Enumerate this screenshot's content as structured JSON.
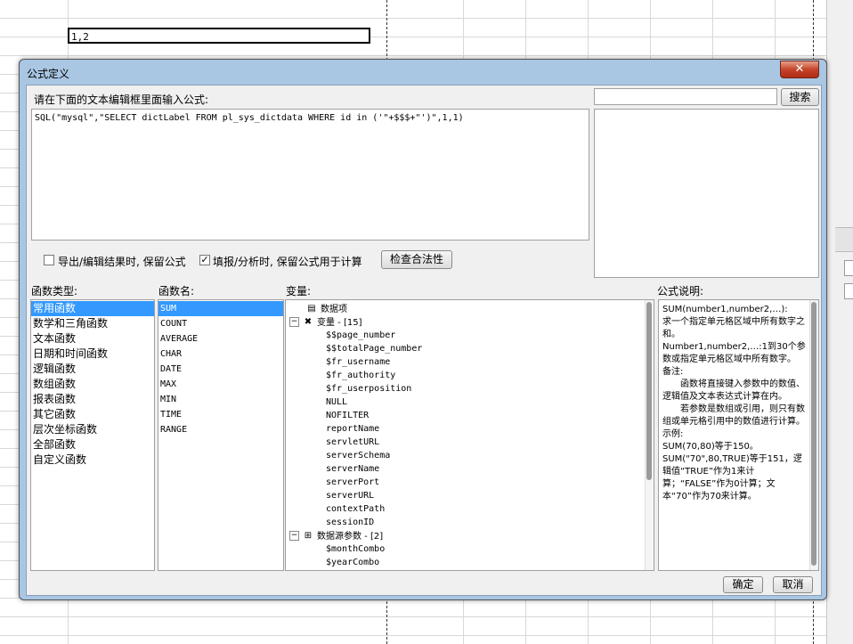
{
  "sheet": {
    "cell_value": "1,2"
  },
  "dialog": {
    "title": "公式定义",
    "close_glyph": "✕",
    "editor_label": "请在下面的文本编辑框里面输入公式:",
    "formula": "SQL(\"mysql\",\"SELECT dictLabel FROM pl_sys_dictdata WHERE id in ('\"+$$$+\"')\",1,1)",
    "search_placeholder": "",
    "search_button": "搜索",
    "option1_label": "导出/编辑结果时, 保留公式",
    "option1_checked": false,
    "option2_label": "填报/分析时, 保留公式用于计算",
    "option2_checked": true,
    "check_button": "检查合法性",
    "func_type_label": "函数类型:",
    "func_types": [
      "常用函数",
      "数学和三角函数",
      "文本函数",
      "日期和时间函数",
      "逻辑函数",
      "数组函数",
      "报表函数",
      "其它函数",
      "层次坐标函数",
      "全部函数",
      "自定义函数"
    ],
    "func_name_label": "函数名:",
    "func_names": [
      "SUM",
      "COUNT",
      "AVERAGE",
      "CHAR",
      "DATE",
      "MAX",
      "MIN",
      "TIME",
      "RANGE"
    ],
    "variable_label": "变量:",
    "tree": {
      "data_item": "数据项",
      "var_group": "变量 - [15]",
      "vars": [
        "$$page_number",
        "$$totalPage_number",
        "$fr_username",
        "$fr_authority",
        "$fr_userposition",
        "NULL",
        "NOFILTER",
        "reportName",
        "servletURL",
        "serverSchema",
        "serverName",
        "serverPort",
        "serverURL",
        "contextPath",
        "sessionID"
      ],
      "ds_group": "数据源参数 - [2]",
      "ds_params": [
        "$monthCombo",
        "$yearCombo"
      ]
    },
    "desc_label": "公式说明:",
    "desc_lines": [
      "SUM(number1,number2,…):",
      "求一个指定单元格区域中所有数字之和。",
      "Number1,number2,…:1到30个参数或指定单元格区域中所有数字。",
      "备注:",
      "　　函数将直接键入参数中的数值、逻辑值及文本表达式计算在内。",
      "　　若参数是数组或引用，则只有数组或单元格引用中的数值进行计算。",
      "示例:",
      "SUM(70,80)等于150。",
      "SUM(\"70\",80,TRUE)等于151，逻辑值“TRUE”作为1来计算；“FALSE”作为0计算；文本“70”作为70来计算。"
    ],
    "ok_button": "确定",
    "cancel_button": "取消"
  }
}
